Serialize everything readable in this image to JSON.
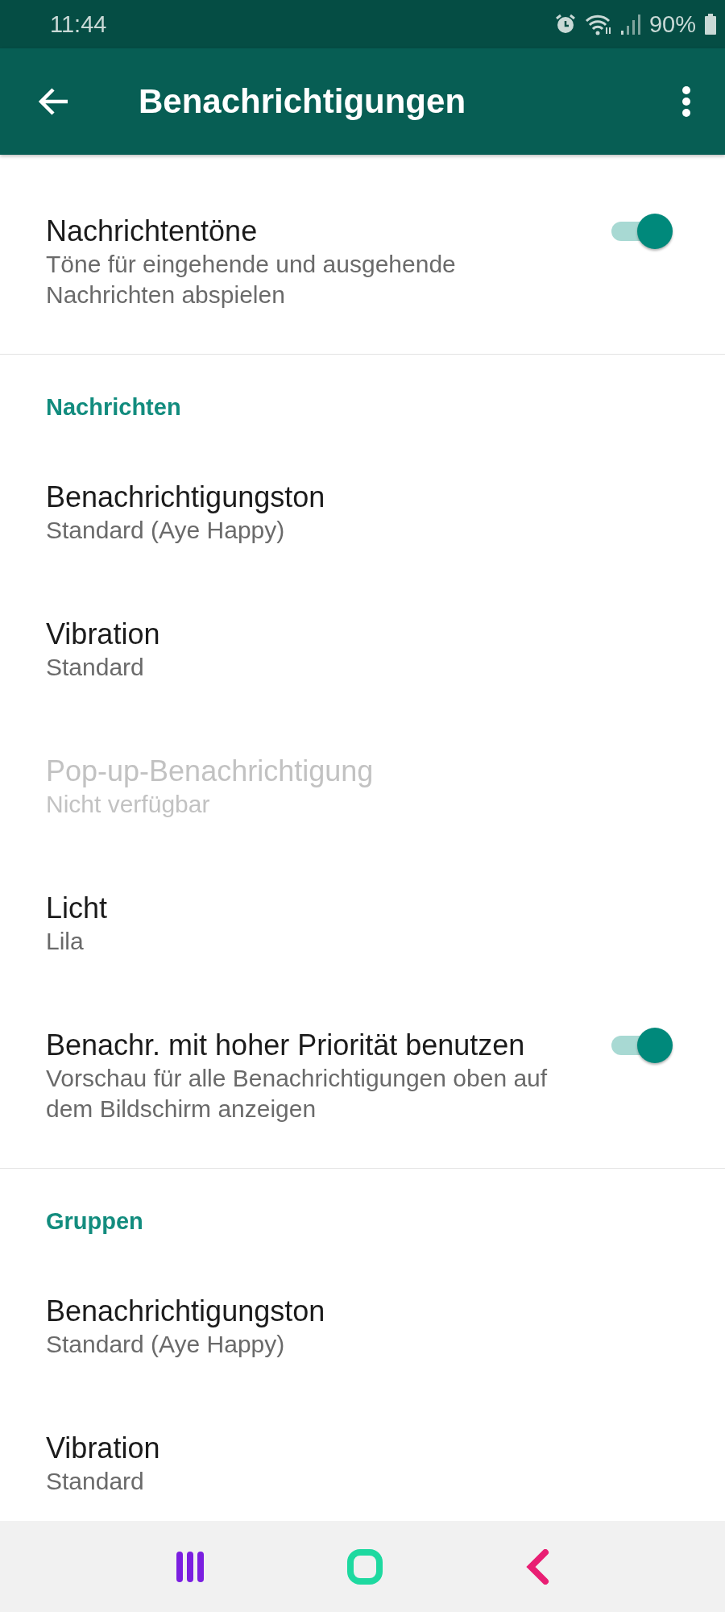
{
  "status_bar": {
    "time": "11:44",
    "battery": "90%"
  },
  "app_bar": {
    "title": "Benachrichtigungen"
  },
  "sections": [
    {
      "items": [
        {
          "kind": "toggle",
          "title": "Nachrichtentöne",
          "subtitle": "Töne für eingehende und ausgehende Nachrichten abspielen",
          "on": true,
          "disabled": false
        }
      ]
    },
    {
      "header": "Nachrichten",
      "items": [
        {
          "kind": "option",
          "title": "Benachrichtigungston",
          "subtitle": "Standard (Aye Happy)",
          "disabled": false
        },
        {
          "kind": "option",
          "title": "Vibration",
          "subtitle": "Standard",
          "disabled": false
        },
        {
          "kind": "option",
          "title": "Pop-up-Benachrichtigung",
          "subtitle": "Nicht verfügbar",
          "disabled": true
        },
        {
          "kind": "option",
          "title": "Licht",
          "subtitle": "Lila",
          "disabled": false
        },
        {
          "kind": "toggle",
          "title": "Benachr. mit hoher Priorität benutzen",
          "subtitle": "Vorschau für alle Benachrichtigungen oben auf dem Bildschirm anzeigen",
          "on": true,
          "disabled": false
        }
      ]
    },
    {
      "header": "Gruppen",
      "items": [
        {
          "kind": "option",
          "title": "Benachrichtigungston",
          "subtitle": "Standard (Aye Happy)",
          "disabled": false
        },
        {
          "kind": "option",
          "title": "Vibration",
          "subtitle": "Standard",
          "disabled": false
        }
      ]
    }
  ]
}
